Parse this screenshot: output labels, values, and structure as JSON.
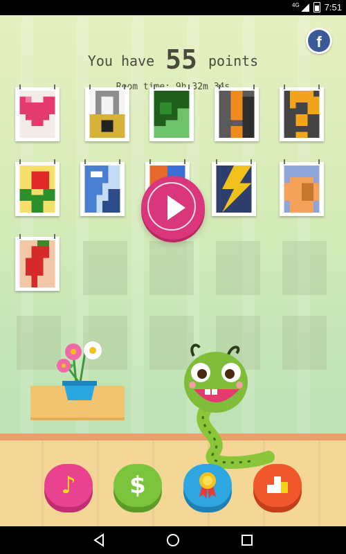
{
  "status_bar": {
    "network": "4G",
    "time": "7:51"
  },
  "header": {
    "points_prefix": "You have",
    "points_value": "55",
    "points_suffix": "points",
    "room_time_label": "Room time:",
    "room_time_value": "9h 32m 34s"
  },
  "social": {
    "facebook_glyph": "f"
  },
  "puzzles": [
    {
      "name": "heart",
      "colors": [
        "#e43b6f",
        "#c92b5a",
        "#f07aa0"
      ]
    },
    {
      "name": "padlock",
      "colors": [
        "#9a9a9a",
        "#d7b23a",
        "#222222"
      ]
    },
    {
      "name": "leaf",
      "colors": [
        "#2f8a2a",
        "#1f5e1c",
        "#6dc26a"
      ]
    },
    {
      "name": "exclamation",
      "colors": [
        "#f08a1e",
        "#5a5a5a",
        "#2d2d2d"
      ]
    },
    {
      "name": "question",
      "colors": [
        "#f2a51c",
        "#333333",
        "#666666"
      ]
    },
    {
      "name": "rose",
      "colors": [
        "#e02a2a",
        "#2c8f2c",
        "#f6e06a"
      ]
    },
    {
      "name": "ice-pop",
      "colors": [
        "#4a7fcf",
        "#c5dcf4",
        "#2d4c8a"
      ]
    },
    {
      "name": "hidden-behind-play",
      "colors": [
        "#e86a2a",
        "#3b6fd6",
        "#f0c94a"
      ]
    },
    {
      "name": "lightning",
      "colors": [
        "#f2c21c",
        "#2e3f6e",
        "#16264a"
      ]
    },
    {
      "name": "vase",
      "colors": [
        "#f5a25a",
        "#8fa7d8",
        "#c7772b"
      ]
    },
    {
      "name": "chili-pepper",
      "colors": [
        "#d62a2a",
        "#3a8a2a",
        "#f2c6a6"
      ]
    }
  ],
  "empty_slots": 9,
  "play_button": {
    "icon": "play-icon"
  },
  "bottom_buttons": [
    {
      "name": "music",
      "icon": "music-note-icon",
      "glyph": "♪",
      "color": "#e94390",
      "shade": "#c22d72"
    },
    {
      "name": "shop",
      "icon": "dollar-icon",
      "glyph": "$",
      "color": "#7cc43c",
      "shade": "#5c9b28"
    },
    {
      "name": "achievements",
      "icon": "medal-icon",
      "glyph": "",
      "color": "#2fa6e0",
      "shade": "#1f80b4"
    },
    {
      "name": "leaderboard",
      "icon": "podium-icon",
      "glyph": "",
      "color": "#f0572a",
      "shade": "#c33f1a"
    }
  ],
  "nav": {
    "back_icon": "back-icon",
    "home_icon": "home-icon",
    "recents_icon": "recents-icon"
  }
}
